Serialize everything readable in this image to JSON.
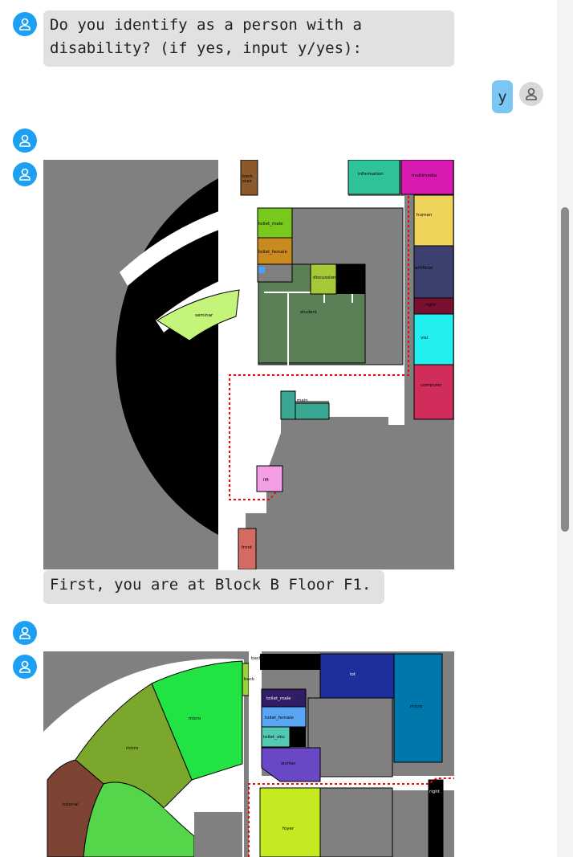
{
  "chat": {
    "question": "Do you identify as a person with a\ndisability? (if yes, input y/yes):",
    "user_reply": "y",
    "caption1": "First, you are at Block B Floor F1."
  },
  "map1": {
    "labels": {
      "back_stair": "back\nstair",
      "info_lab": "information\nsystem\nresearch\nlab",
      "multimedia": "multimedia\nresearch\nlab",
      "hci": "human\ncomputer\ninteraction\nresearch\nlab",
      "ai": "artificial\nintelligence\nresearch\nlab",
      "right_stair": "right\nstair",
      "visi": "visi\nresearch\nlab",
      "comp_sys": "computer\nsystems\nand\nnetwork\nresearch\nlab",
      "toilet_male": "toilet_male",
      "toilet_female": "toilet_female",
      "discussion": "discussion\nroom\n1",
      "student_lounge": "student\nlounge",
      "seminar": "seminar\nroom\n3",
      "main_stair": "main\nstair\n-\ndown",
      "lift": "lift",
      "front_stair": "front\nstair",
      "toilet_oku_short": "to"
    }
  },
  "map2": {
    "labels": {
      "back_entrance": "back\nent",
      "back_stair": "back\nstair",
      "iot_lab": "iot\nlab",
      "micro_lab5": "micro\nlab\n5",
      "micro_lab4": "micro\nlab\n4",
      "micro_lab3": "micro\nlab\n3",
      "tutorial_room": "tutorial\nroom\n9",
      "toilet_male": "toilet_male",
      "toilet_female": "toilet_female",
      "toilet_oku": "toilet_oku",
      "worker_office": "worker\noffice",
      "foyer": "foyer",
      "right_stair": "right\nstair"
    }
  },
  "colors": {
    "bot_avatar": "#1ea0f2",
    "user_bubble": "#7cc6f4",
    "route": "#ff0000"
  },
  "icons": {
    "bot_avatar": "person-icon",
    "user_avatar": "person-icon"
  }
}
